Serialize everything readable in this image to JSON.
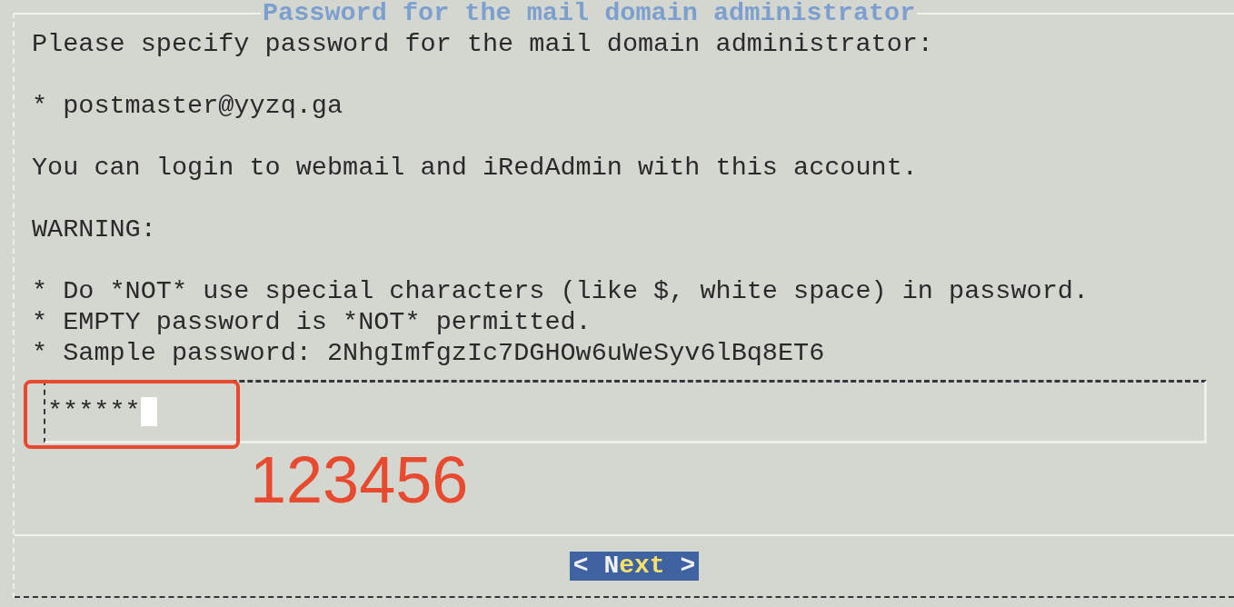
{
  "dialog": {
    "title": "Password for the mail domain administrator",
    "paragraphs": [
      {
        "lines": [
          "Please specify password for the mail domain administrator:"
        ]
      },
      {
        "lines": [
          "* postmaster@yyzq.ga"
        ]
      },
      {
        "lines": [
          "You can login to webmail and iRedAdmin with this account."
        ]
      },
      {
        "lines": [
          "WARNING:"
        ]
      },
      {
        "lines": [
          "* Do *NOT* use special characters (like $, white space) in password.",
          "* EMPTY password is *NOT* permitted.",
          "* Sample password: 2NhgImfgzIc7DGHOw6uWeSyv6lBq8ET6"
        ]
      }
    ],
    "password_field": {
      "value": "******",
      "highlighted": true
    },
    "annotation": "123456",
    "button": {
      "left": "<",
      "label": "Next",
      "right": ">",
      "selected": true
    }
  }
}
